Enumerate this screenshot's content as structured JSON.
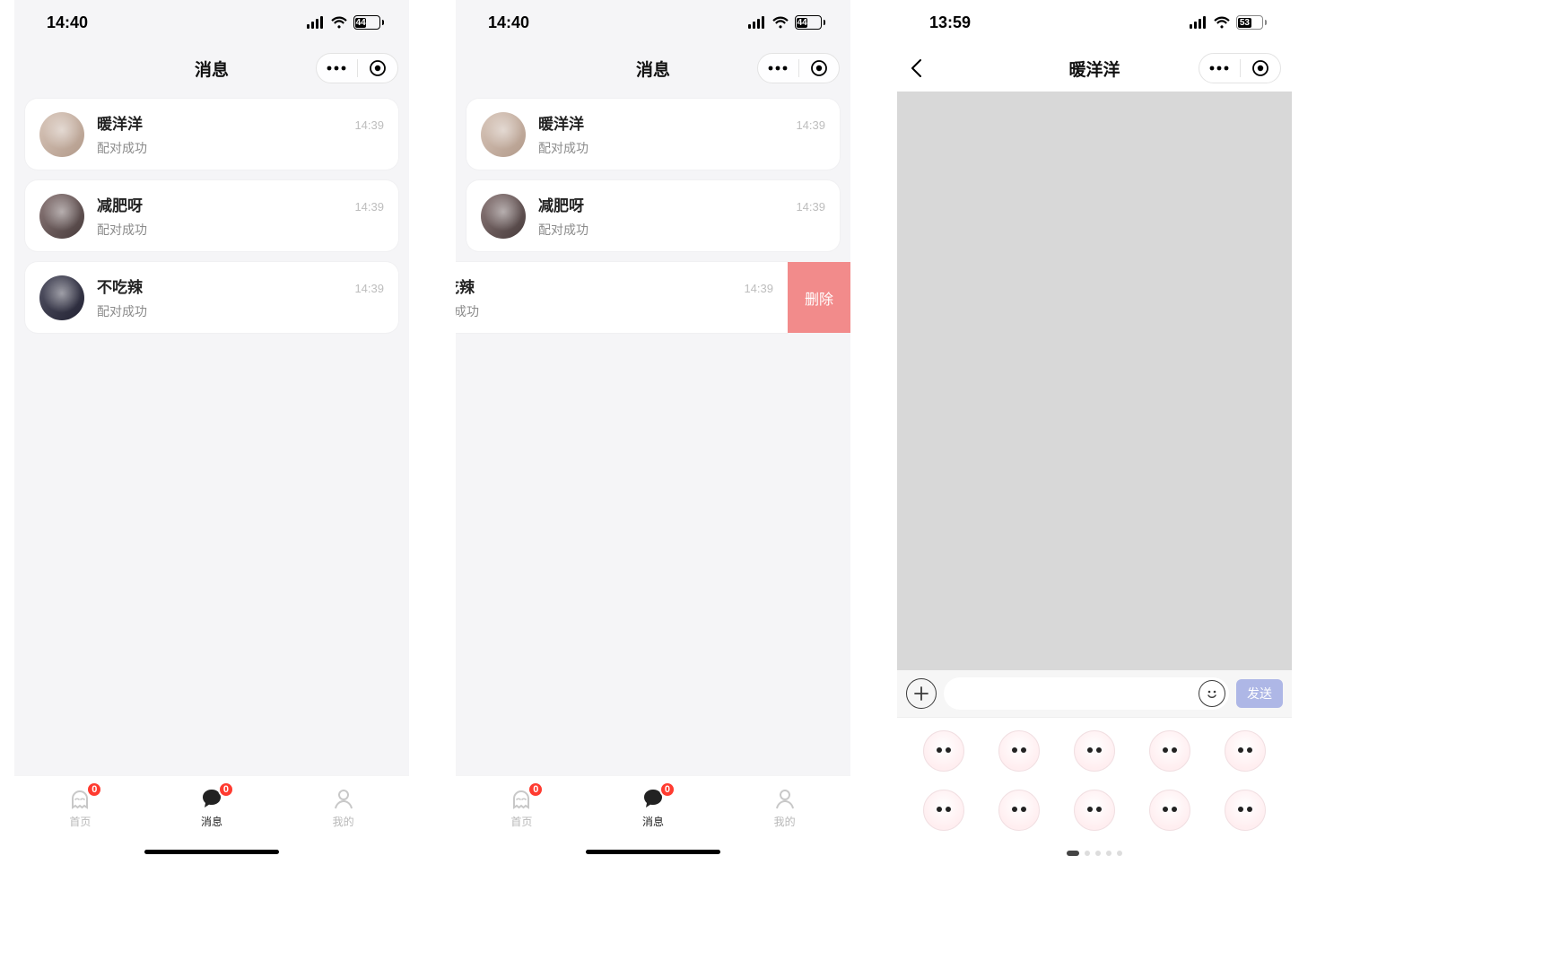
{
  "screens": {
    "list": {
      "status": {
        "time": "14:40",
        "battery": "44"
      },
      "title": "消息",
      "items": [
        {
          "name": "暖洋洋",
          "sub": "配对成功",
          "time": "14:39"
        },
        {
          "name": "减肥呀",
          "sub": "配对成功",
          "time": "14:39"
        },
        {
          "name": "不吃辣",
          "sub": "配对成功",
          "time": "14:39"
        }
      ],
      "tabs": {
        "home": {
          "label": "首页",
          "badge": "0"
        },
        "msg": {
          "label": "消息",
          "badge": "0"
        },
        "mine": {
          "label": "我的"
        }
      }
    },
    "swipe": {
      "status": {
        "time": "14:40",
        "battery": "44"
      },
      "title": "消息",
      "items": [
        {
          "name": "暖洋洋",
          "sub": "配对成功",
          "time": "14:39"
        },
        {
          "name": "减肥呀",
          "sub": "配对成功",
          "time": "14:39"
        },
        {
          "name": "不吃辣",
          "sub": "配对成功",
          "time": "14:39"
        }
      ],
      "delete_label": "删除",
      "tabs": {
        "home": {
          "label": "首页",
          "badge": "0"
        },
        "msg": {
          "label": "消息",
          "badge": "0"
        },
        "mine": {
          "label": "我的"
        }
      }
    },
    "chat": {
      "status": {
        "time": "13:59",
        "battery": "53"
      },
      "title": "暖洋洋",
      "send_label": "发送",
      "input_placeholder": "",
      "stickers": [
        {
          "caption": ""
        },
        {
          "caption": ""
        },
        {
          "caption": ""
        },
        {
          "caption": ""
        },
        {
          "caption": ""
        },
        {
          "caption": ""
        },
        {
          "caption": ""
        },
        {
          "caption": ""
        },
        {
          "caption": ""
        },
        {
          "caption": ""
        }
      ]
    }
  }
}
